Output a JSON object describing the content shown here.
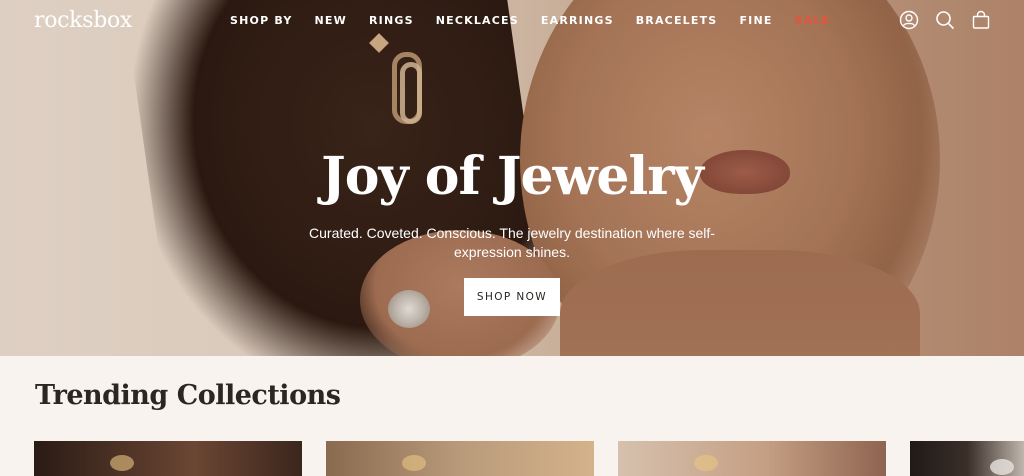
{
  "brand": {
    "logo": "rocksbox"
  },
  "nav": {
    "items": [
      {
        "label": "SHOP BY"
      },
      {
        "label": "NEW"
      },
      {
        "label": "RINGS"
      },
      {
        "label": "NECKLACES"
      },
      {
        "label": "EARRINGS"
      },
      {
        "label": "BRACELETS"
      },
      {
        "label": "FINE"
      },
      {
        "label": "SALE"
      }
    ],
    "icons": [
      "account-icon",
      "search-icon",
      "bag-icon"
    ],
    "sale_color": "#e2553d"
  },
  "hero": {
    "title": "Joy of Jewelry",
    "subtitle": "Curated. Coveted. Conscious. The jewelry destination where self-expression shines.",
    "button_label": "SHOP NOW"
  },
  "trending": {
    "title": "Trending Collections",
    "cards_visible": 4
  }
}
